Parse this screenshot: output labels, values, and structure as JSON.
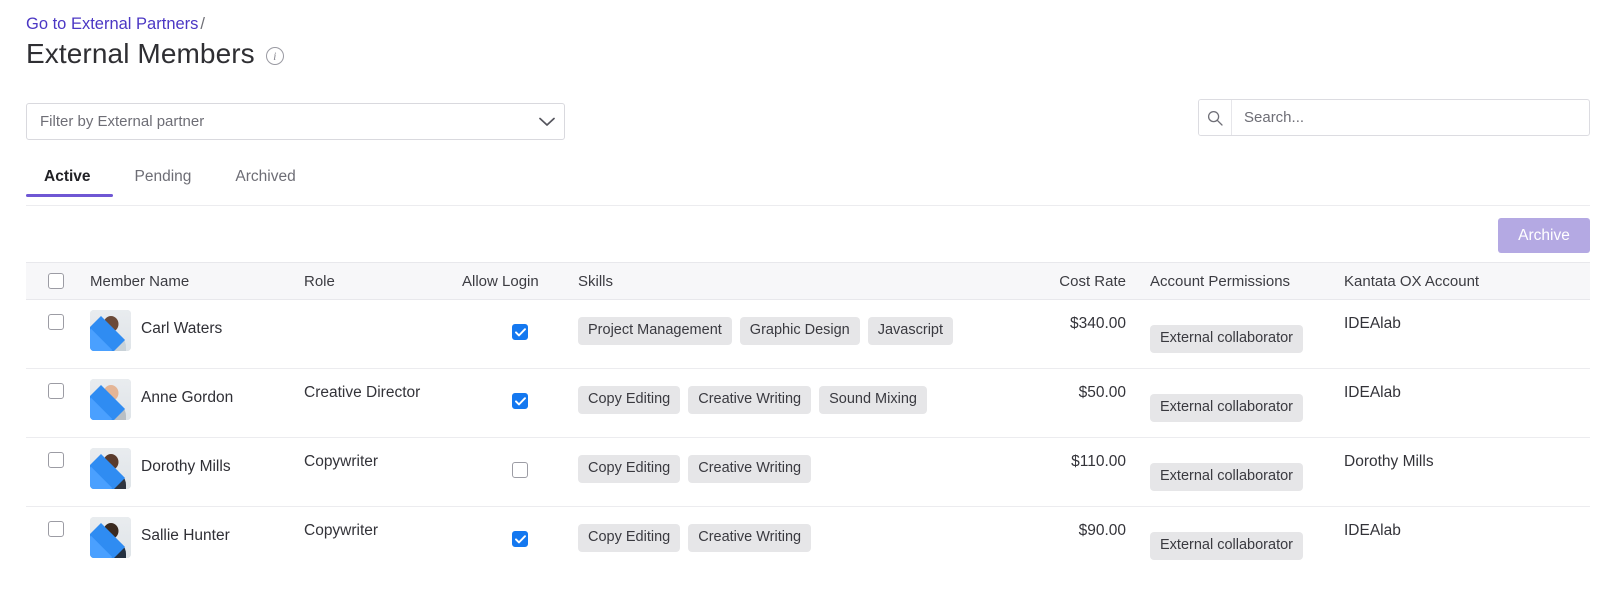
{
  "breadcrumb": {
    "link_label": "Go to External Partners",
    "separator": "/"
  },
  "header": {
    "title": "External Members",
    "info_icon": "info-circle-icon"
  },
  "filter": {
    "placeholder": "Filter by External partner",
    "chevron_icon": "chevron-down-icon"
  },
  "search": {
    "placeholder": "Search...",
    "value": "",
    "icon": "search-icon"
  },
  "tabs": [
    {
      "label": "Active",
      "active": true
    },
    {
      "label": "Pending",
      "active": false
    },
    {
      "label": "Archived",
      "active": false
    }
  ],
  "toolbar": {
    "archive_label": "Archive",
    "archive_color": "#b4a9e3"
  },
  "table": {
    "columns": {
      "select": "",
      "member_name": "Member Name",
      "role": "Role",
      "allow_login": "Allow Login",
      "skills": "Skills",
      "cost_rate": "Cost Rate",
      "account_permissions": "Account Permissions",
      "kantata_account": "Kantata OX Account"
    },
    "header_select_all": false,
    "rows": [
      {
        "selected": false,
        "name": "Carl Waters",
        "role": "",
        "allow_login": true,
        "skills": [
          "Project Management",
          "Graphic Design",
          "Javascript"
        ],
        "cost_rate": "$340.00",
        "permission": "External collaborator",
        "account": "IDEAlab"
      },
      {
        "selected": false,
        "name": "Anne Gordon",
        "role": "Creative Director",
        "allow_login": true,
        "skills": [
          "Copy Editing",
          "Creative Writing",
          "Sound Mixing"
        ],
        "cost_rate": "$50.00",
        "permission": "External collaborator",
        "account": "IDEAlab"
      },
      {
        "selected": false,
        "name": "Dorothy Mills",
        "role": "Copywriter",
        "allow_login": false,
        "skills": [
          "Copy Editing",
          "Creative Writing"
        ],
        "cost_rate": "$110.00",
        "permission": "External collaborator",
        "account": "Dorothy Mills"
      },
      {
        "selected": false,
        "name": "Sallie Hunter",
        "role": "Copywriter",
        "allow_login": true,
        "skills": [
          "Copy Editing",
          "Creative Writing"
        ],
        "cost_rate": "$90.00",
        "permission": "External collaborator",
        "account": "IDEAlab"
      }
    ]
  },
  "colors": {
    "accent_purple": "#6f57d4",
    "link_purple": "#4b37c4",
    "checkbox_blue": "#1478f0",
    "chip_gray": "#e6e6e8"
  }
}
